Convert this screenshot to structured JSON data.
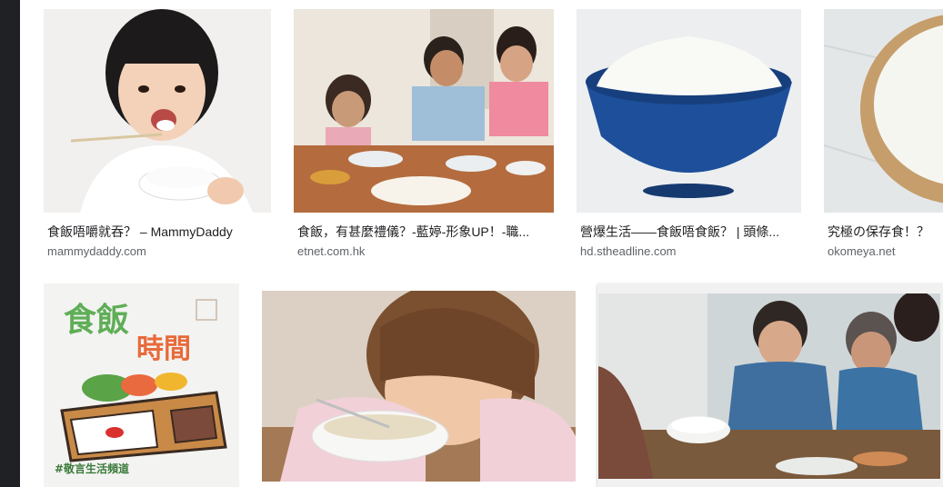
{
  "results": [
    {
      "title": "食飯唔嚼就吞？ – MammyDaddy",
      "source": "mammydaddy.com"
    },
    {
      "title": "食飯，有甚麼禮儀？-藍婷-形象UP！-職...",
      "source": "etnet.com.hk"
    },
    {
      "title": "營爆生活——食飯唔食飯？ | 頭條...",
      "source": "hd.stheadline.com"
    },
    {
      "title": "究極の保存食！？",
      "source": "okomeya.net"
    },
    {
      "title": "",
      "source": ""
    },
    {
      "title": "",
      "source": ""
    },
    {
      "title": "",
      "source": ""
    }
  ],
  "images": {
    "r5_heading_1": "食飯",
    "r5_heading_2": "時間",
    "r5_footer": "#敬言生活頻道"
  }
}
